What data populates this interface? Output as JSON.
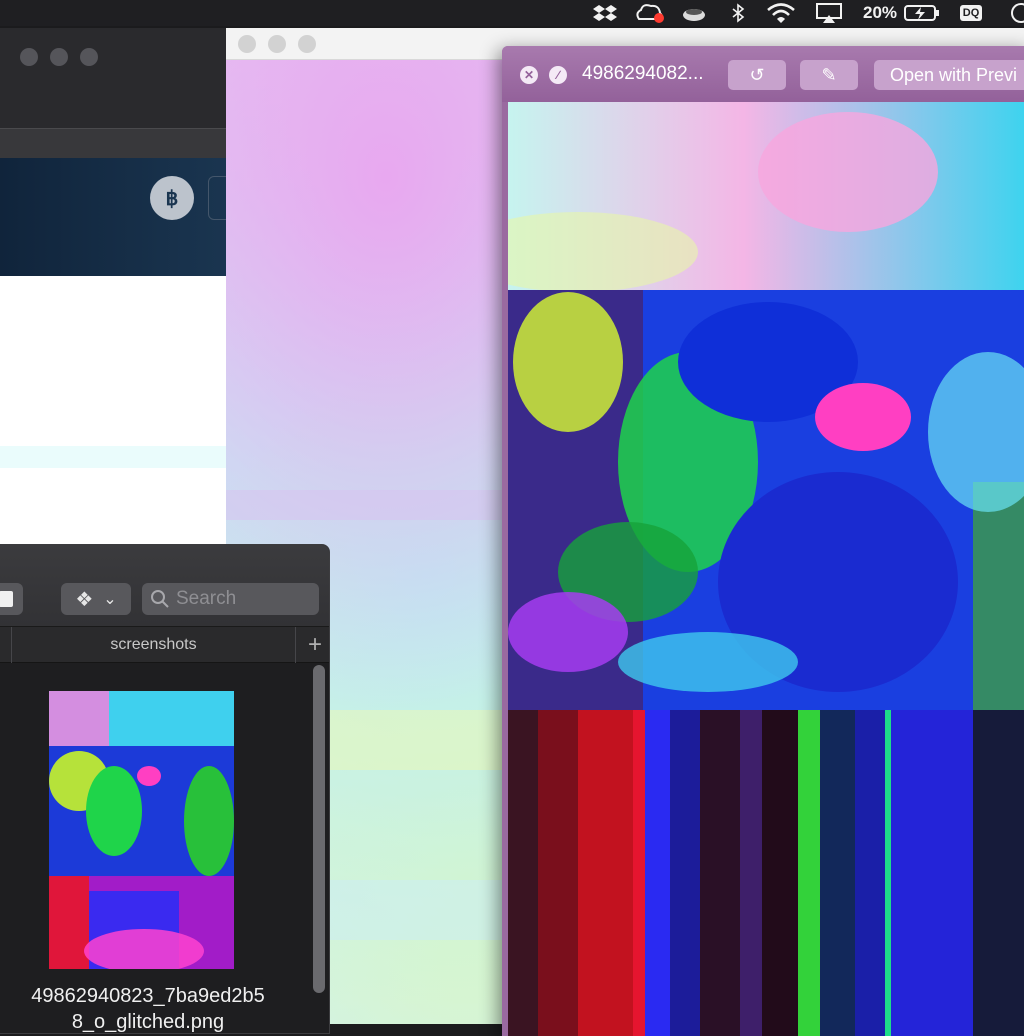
{
  "menubar": {
    "battery_percent": "20%",
    "user_initials": "DQ",
    "icons": [
      "dropbox-icon",
      "creative-cloud-icon",
      "coffee-icon",
      "bluetooth-icon",
      "wifi-icon",
      "airplay-icon",
      "battery-icon",
      "user-badge",
      "notification-icon"
    ]
  },
  "back_window": {
    "avatar_glyph": "฿"
  },
  "quicklook": {
    "title": "4986294082...",
    "close_glyph": "✕",
    "fullscreen_glyph": "∕",
    "rotate_glyph": "↺",
    "markup_glyph": "✎",
    "open_with_label": "Open with Previ",
    "accent_color": "#9a6aa0"
  },
  "finder": {
    "search_placeholder": "Search",
    "tab_label": "screenshots",
    "add_tab_glyph": "+",
    "dropbox_glyph": "❖",
    "chevron_glyph": "⌄",
    "file_name_line1": "49862940823_7ba9ed2b5",
    "file_name_line2": "8_o_glitched.png"
  }
}
